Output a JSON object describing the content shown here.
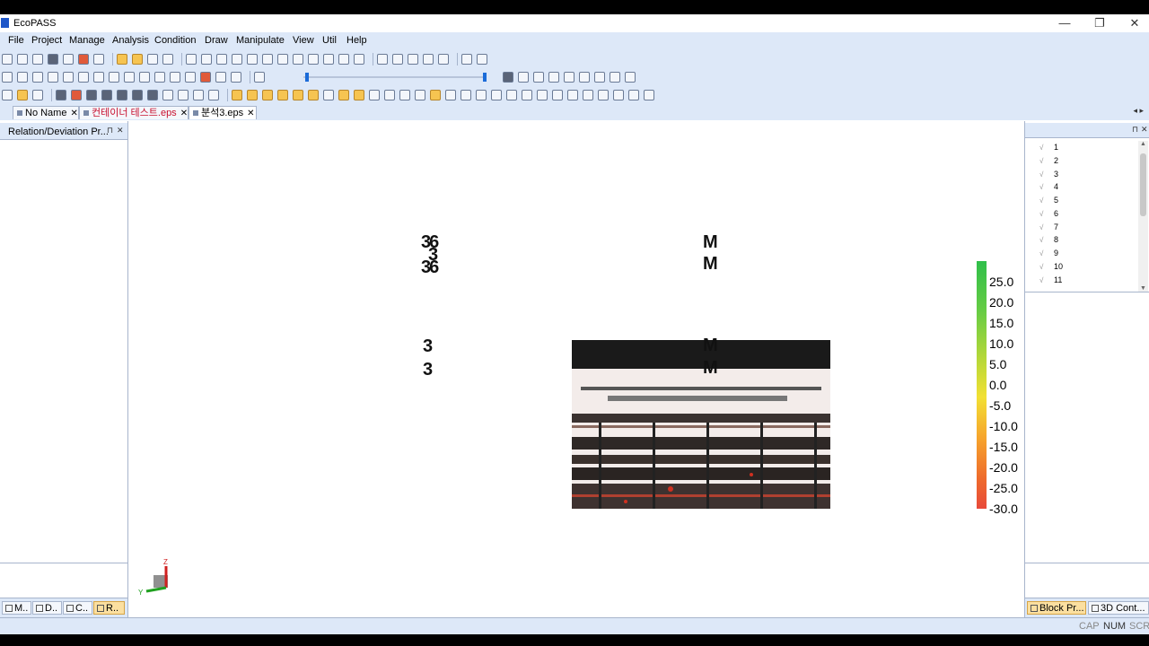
{
  "window": {
    "title": "EcoPASS",
    "minimize": "—",
    "restore": "❐",
    "close": "✕"
  },
  "menu": [
    "File",
    "Project",
    "Manage",
    "Analysis",
    "Condition",
    "Draw",
    "Manipulate",
    "View",
    "Util",
    "Help"
  ],
  "doc_tabs": [
    {
      "label": "No Name",
      "close": "✕",
      "active": false
    },
    {
      "label": "컨테이너 테스트.eps",
      "close": "✕",
      "active": false
    },
    {
      "label": "분석3.eps",
      "close": "✕",
      "active": true
    }
  ],
  "tab_nav": "◂ ▸",
  "left_panel": {
    "title": "Relation/Deviation Pr...",
    "pin": "⊓",
    "close": "✕",
    "bottom_tabs": [
      {
        "label": "M..",
        "active": false
      },
      {
        "label": "D..",
        "active": false
      },
      {
        "label": "C..",
        "active": false
      },
      {
        "label": "R..",
        "active": true
      }
    ]
  },
  "viewport": {
    "legend": {
      "values": [
        "25.0",
        "20.0",
        "15.0",
        "10.0",
        "5.0",
        "0.0",
        "-5.0",
        "-10.0",
        "-15.0",
        "-20.0",
        "-25.0",
        "-30.0"
      ],
      "max": 25.0,
      "min": -30.0,
      "colors": {
        "top": "#2fbf4a",
        "mid": "#f2e034",
        "bottom": "#e84a3a"
      }
    },
    "model_labels": [
      "36",
      "3",
      "36",
      "M",
      "M",
      "3",
      "M",
      "3",
      "M"
    ],
    "axis": {
      "z": "Z",
      "y": "Y"
    }
  },
  "right_panel": {
    "pin": "⊓",
    "close": "✕",
    "tree_items": [
      "1",
      "2",
      "3",
      "4",
      "5",
      "6",
      "7",
      "8",
      "9",
      "10",
      "11"
    ],
    "check_glyph": "√",
    "bottom_tabs": [
      {
        "label": "Block Pr...",
        "active": true
      },
      {
        "label": "3D Cont...",
        "active": false
      }
    ]
  },
  "status": {
    "cap": "CAP",
    "num": "NUM",
    "scrl": "SCRL"
  }
}
